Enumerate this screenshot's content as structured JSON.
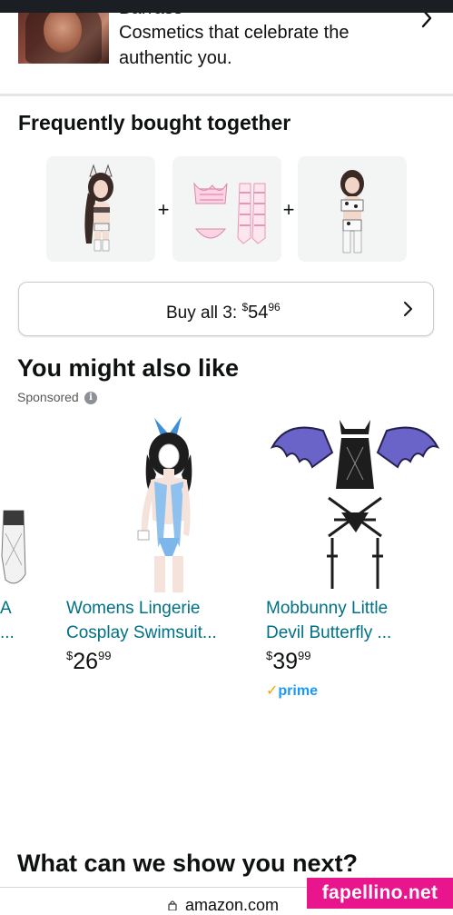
{
  "brand": {
    "name": "Barrass",
    "description": "Cosmetics that celebrate the authentic you."
  },
  "fbt": {
    "title": "Frequently bought together",
    "plus": "+",
    "buy_all_label": "Buy all 3: ",
    "buy_all_price": {
      "symbol": "$",
      "whole": "54",
      "cents": "96"
    }
  },
  "recommendations": {
    "title": "You might also like",
    "sponsored": "Sponsored",
    "info": "i",
    "partial_card": {
      "line1": "A",
      "line2": "..."
    },
    "items": [
      {
        "line1": "Womens Lingerie",
        "line2": "Cosplay Swimsuit...",
        "price": {
          "symbol": "$",
          "whole": "26",
          "cents": "99"
        }
      },
      {
        "line1": "Mobbunny Little",
        "line2": "Devil Butterfly ...",
        "price": {
          "symbol": "$",
          "whole": "39",
          "cents": "99"
        },
        "badge": "prime"
      }
    ]
  },
  "prime_badge": {
    "check": "✓",
    "text": "prime"
  },
  "next_section": {
    "title": "What can we show you next?"
  },
  "browser": {
    "url": "amazon.com"
  },
  "watermark": "fapellino.net",
  "colors": {
    "link": "#007185",
    "prime": "#1a98ff",
    "prime_check": "#f0a500",
    "watermark_bg": "#e9158d"
  }
}
